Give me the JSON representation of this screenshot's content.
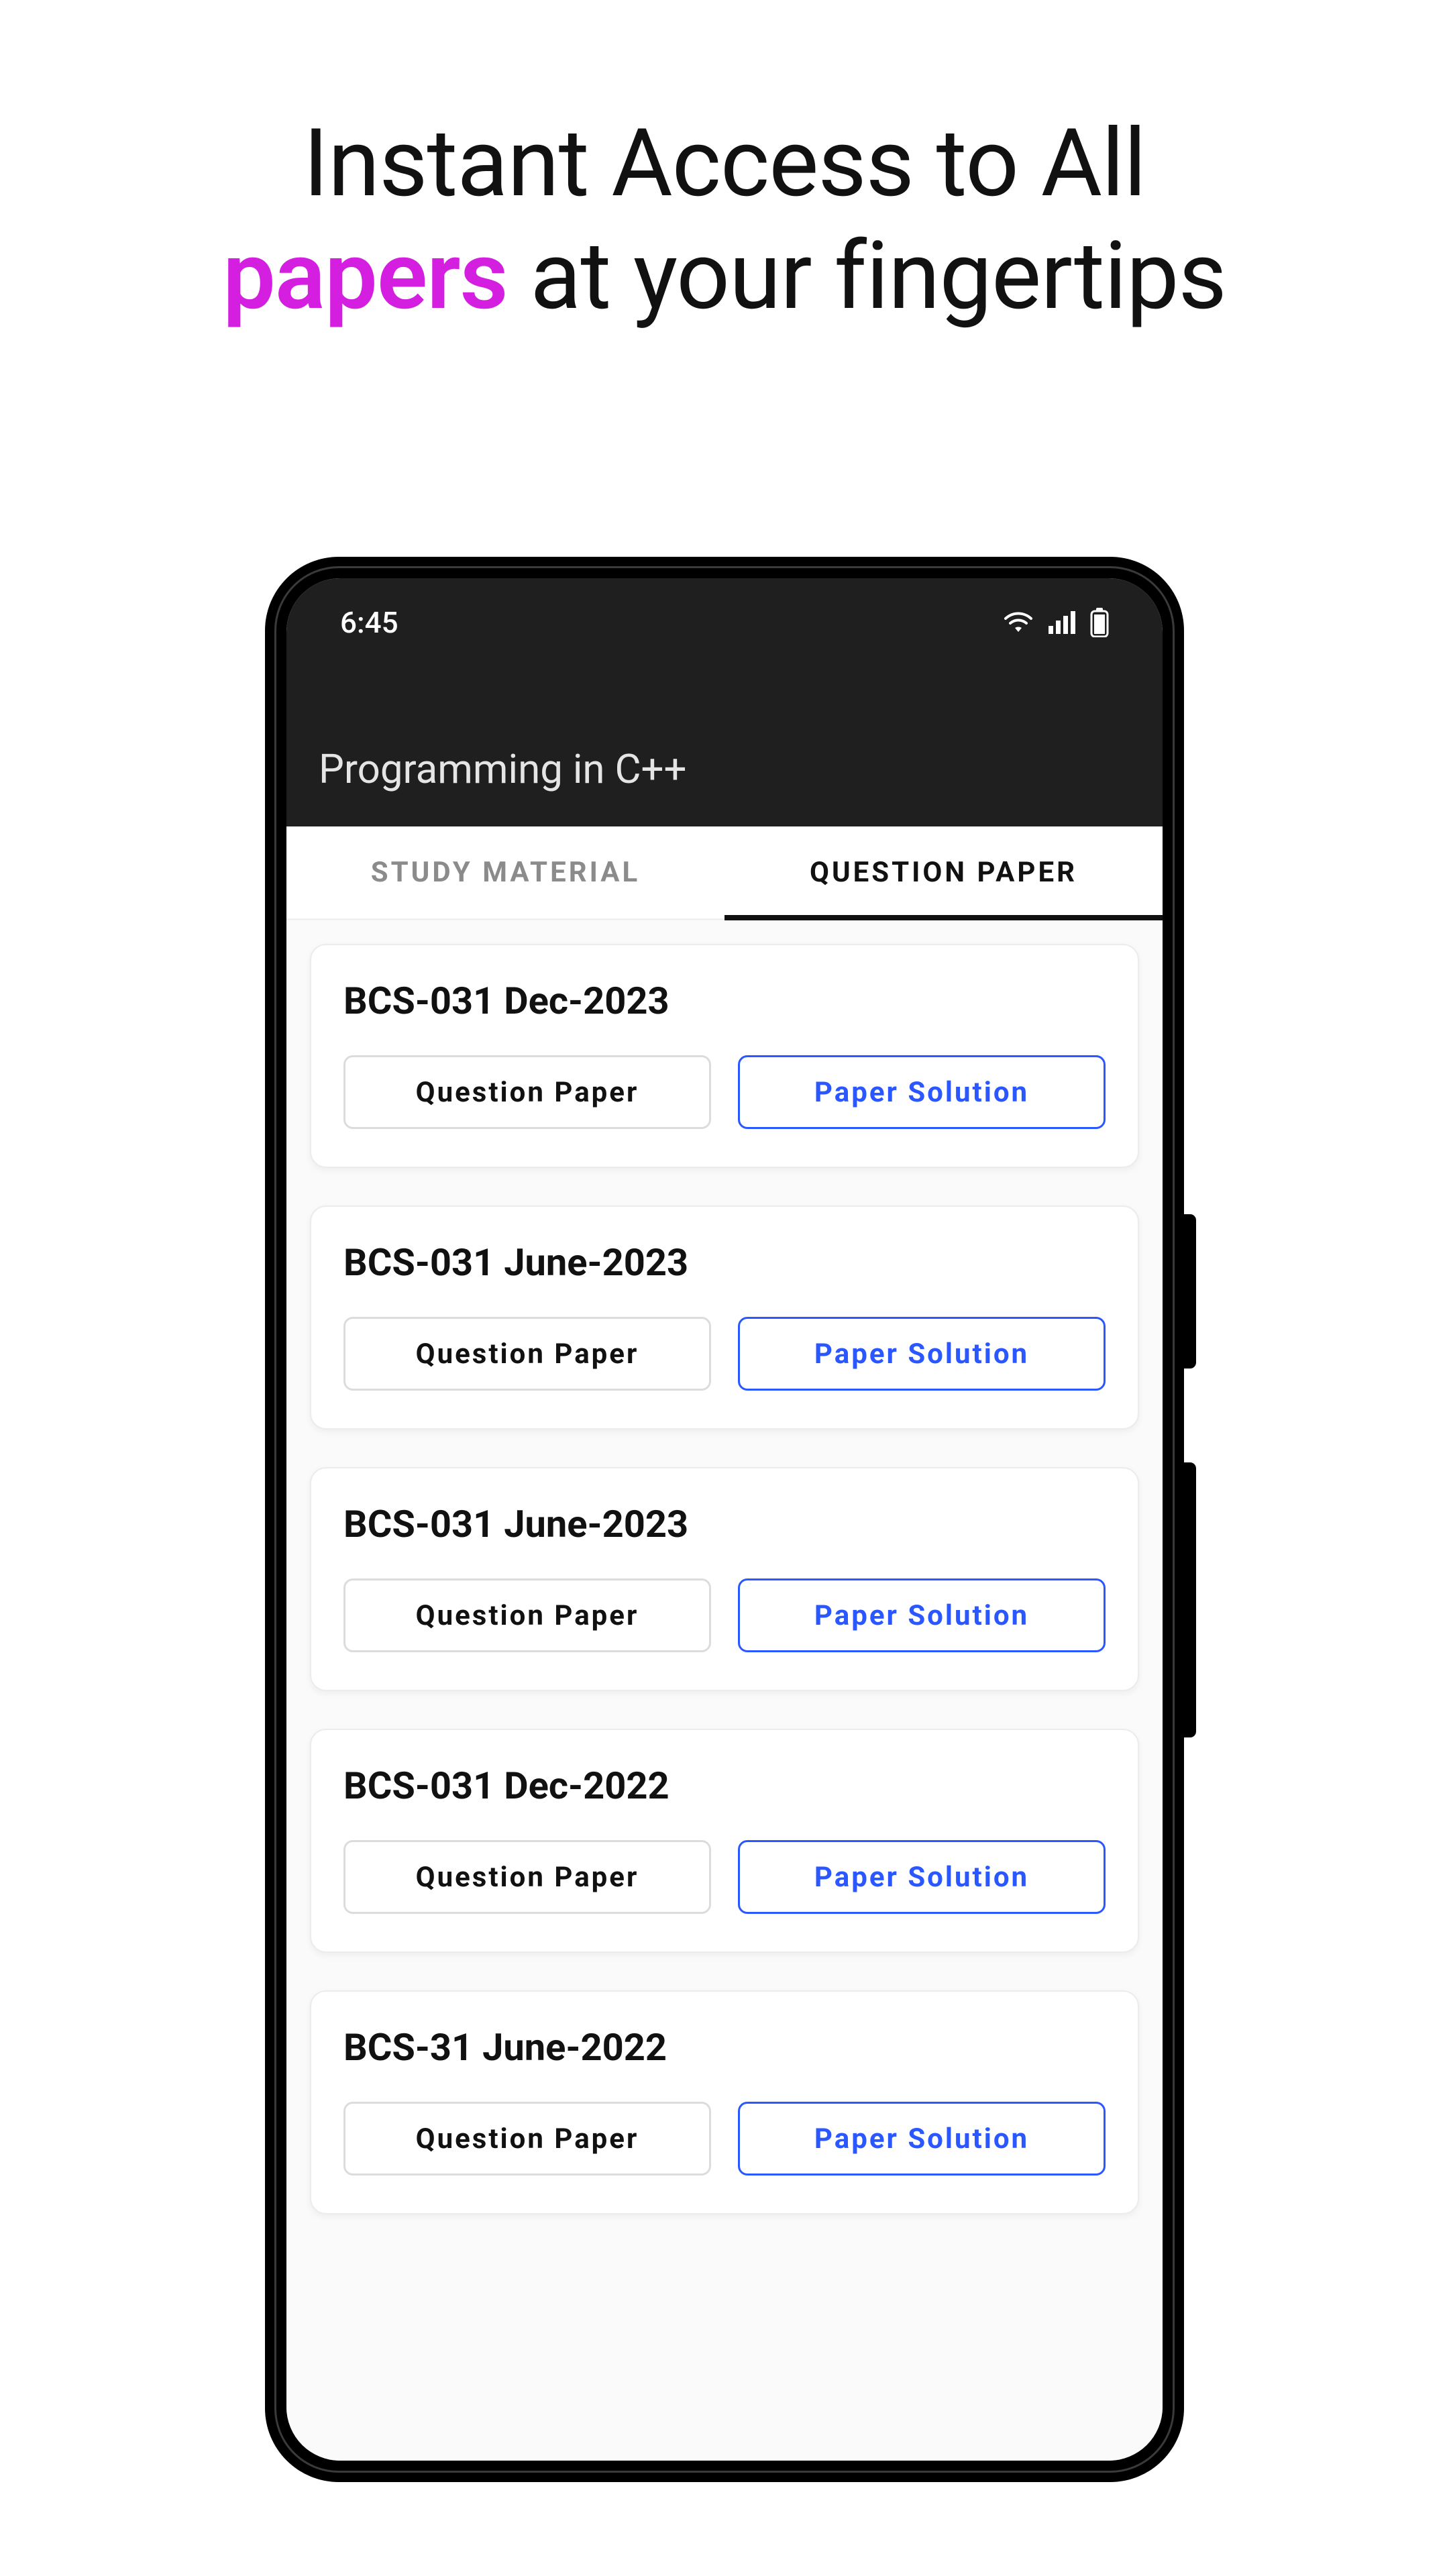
{
  "headline": {
    "line1": "Instant Access to All",
    "accent": "papers",
    "line2_rest": " at your fingertips"
  },
  "statusbar": {
    "time": "6:45",
    "icons": {
      "wifi": "wifi-icon",
      "signal": "signal-icon",
      "battery": "battery-icon"
    }
  },
  "appbar": {
    "title": "Programming in C++"
  },
  "tabs": {
    "study_material": "STUDY MATERIAL",
    "question_paper": "QUESTION PAPER",
    "active_index": 1
  },
  "buttons": {
    "question_paper": "Question Paper",
    "paper_solution": "Paper Solution"
  },
  "papers": [
    {
      "title": "BCS-031 Dec-2023"
    },
    {
      "title": "BCS-031 June-2023"
    },
    {
      "title": "BCS-031 June-2023"
    },
    {
      "title": "BCS-031 Dec-2022"
    },
    {
      "title": "BCS-31 June-2022"
    }
  ]
}
